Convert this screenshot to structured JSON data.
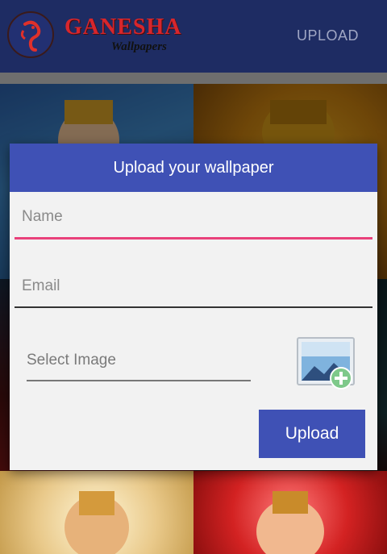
{
  "app": {
    "title": "GANESHA",
    "subtitle": "Wallpapers",
    "upload_action": "UPLOAD"
  },
  "dialog": {
    "title": "Upload your wallpaper",
    "name_placeholder": "Name",
    "email_placeholder": "Email",
    "select_image_label": "Select Image",
    "upload_button": "Upload"
  },
  "colors": {
    "appbar": "#1e2c63",
    "accent": "#3f51b5",
    "focus_underline": "#e9407a"
  },
  "icons": {
    "logo": "ganesha-logo-icon",
    "add_image": "add-image-icon"
  }
}
